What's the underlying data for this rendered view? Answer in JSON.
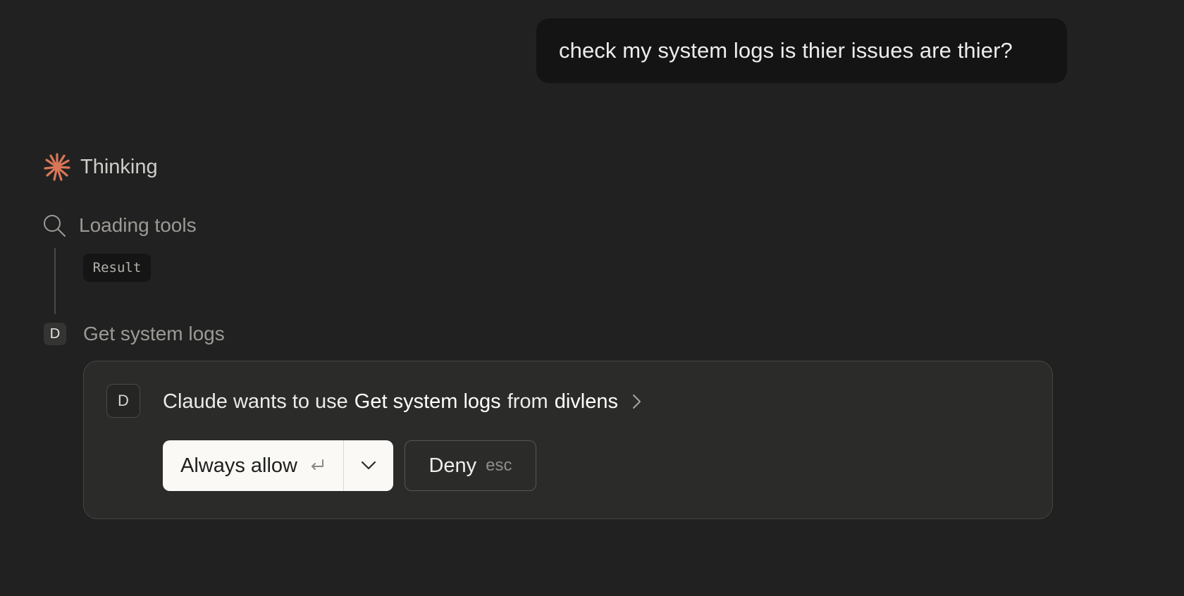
{
  "user_message": {
    "text": "check my system logs is thier issues are thier?"
  },
  "thinking": {
    "icon": "claude-spark-icon",
    "label": "Thinking",
    "accent_color": "#d97757"
  },
  "steps": [
    {
      "icon": "search-icon",
      "label": "Loading tools",
      "result_label": "Result"
    },
    {
      "icon_letter": "D",
      "label": "Get system logs"
    }
  ],
  "permission": {
    "badge_letter": "D",
    "prefix": "Claude wants to use",
    "tool_name": "Get system logs",
    "connector": "from",
    "server_name": "divlens",
    "allow_label": "Always allow",
    "deny_label": "Deny",
    "deny_hint": "esc"
  }
}
